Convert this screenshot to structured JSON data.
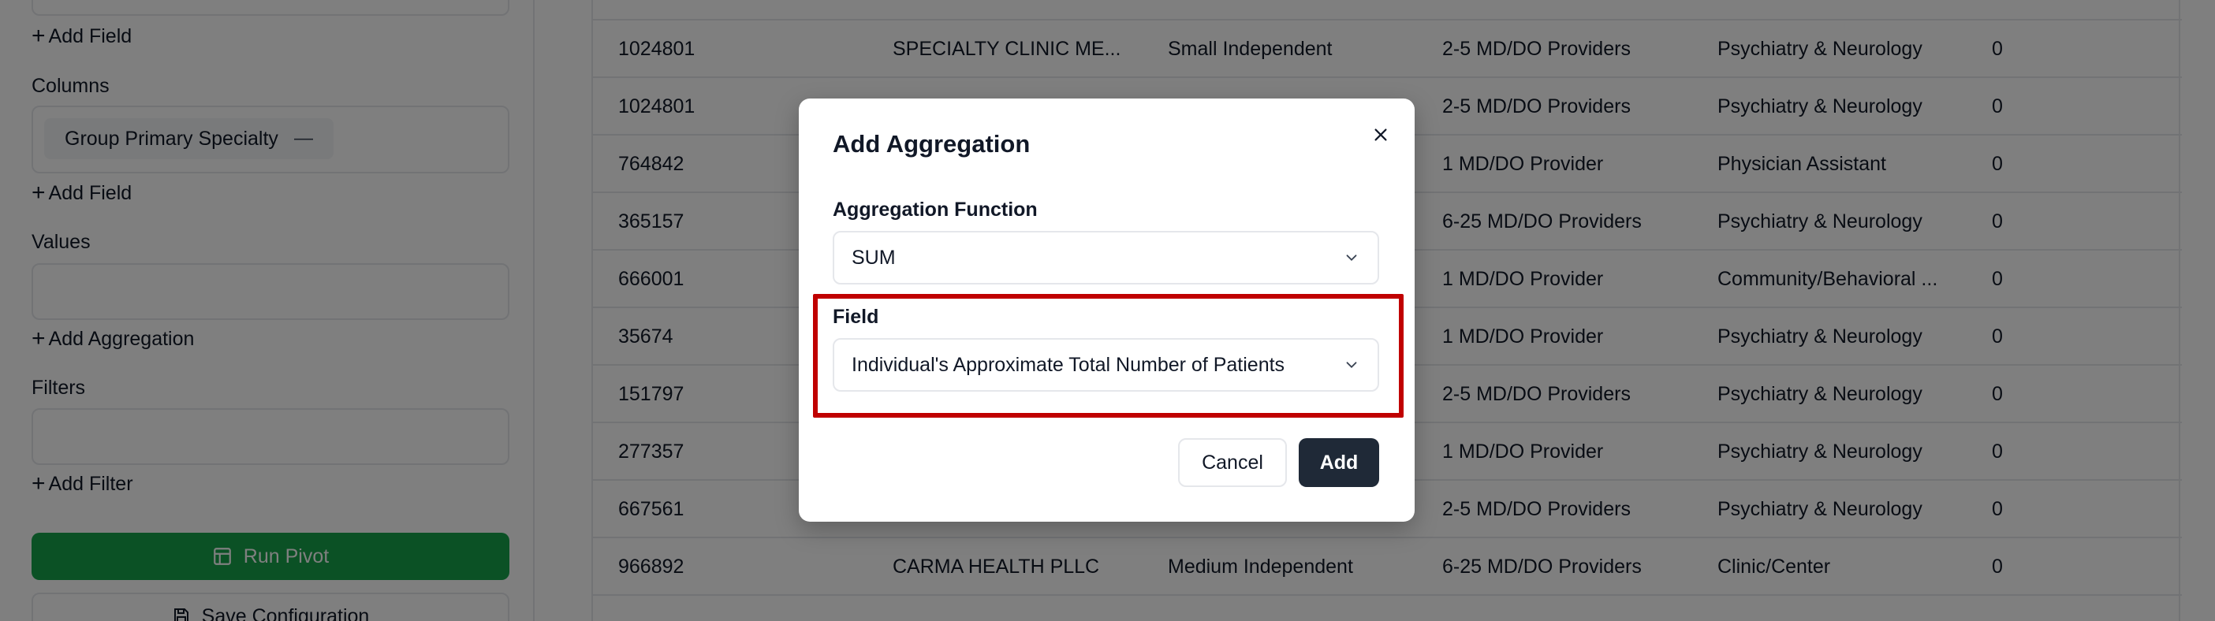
{
  "sidebar": {
    "add_field_rows": "+ Add Field",
    "columns_label": "Columns",
    "column_chip": "Group Primary Specialty",
    "column_chip_remove": "—",
    "add_field_columns": "Add Field",
    "values_label": "Values",
    "add_aggregation": "Add Aggregation",
    "filters_label": "Filters",
    "add_filter": "Add Filter",
    "run_pivot": "Run Pivot",
    "save_configuration": "Save Configuration",
    "add_field_top": "Add Field"
  },
  "table": {
    "rows": [
      [
        "1024801",
        "SPECIALTY CLINIC ME...",
        "Small Independent",
        "2-5 MD/DO Providers",
        "Psychiatry & Neurology",
        "0"
      ],
      [
        "1024801",
        "",
        "",
        "2-5 MD/DO Providers",
        "Psychiatry & Neurology",
        "0"
      ],
      [
        "764842",
        "",
        "",
        "1 MD/DO Provider",
        "Physician Assistant",
        "0"
      ],
      [
        "365157",
        "",
        "",
        "6-25 MD/DO Providers",
        "Psychiatry & Neurology",
        "0"
      ],
      [
        "666001",
        "",
        "",
        "1 MD/DO Provider",
        "Community/Behavioral ...",
        "0"
      ],
      [
        "35674",
        "",
        "",
        "1 MD/DO Provider",
        "Psychiatry & Neurology",
        "0"
      ],
      [
        "151797",
        "",
        "",
        "2-5 MD/DO Providers",
        "Psychiatry & Neurology",
        "0"
      ],
      [
        "277357",
        "",
        "",
        "1 MD/DO Provider",
        "Psychiatry & Neurology",
        "0"
      ],
      [
        "667561",
        "",
        "",
        "2-5 MD/DO Providers",
        "Psychiatry & Neurology",
        "0"
      ],
      [
        "966892",
        "CARMA HEALTH PLLC",
        "Medium Independent",
        "6-25 MD/DO Providers",
        "Clinic/Center",
        "0"
      ]
    ]
  },
  "modal": {
    "title": "Add Aggregation",
    "function_label": "Aggregation Function",
    "function_value": "SUM",
    "field_label": "Field",
    "field_value": "Individual's Approximate Total Number of Patients",
    "cancel_label": "Cancel",
    "add_label": "Add"
  },
  "colors": {
    "run_pivot": "#16a34a",
    "primary_button": "#1f2937",
    "highlight": "#c00000"
  },
  "icons": [
    "plus-icon",
    "table-icon",
    "save-icon",
    "close-icon",
    "chevron-down-icon"
  ]
}
